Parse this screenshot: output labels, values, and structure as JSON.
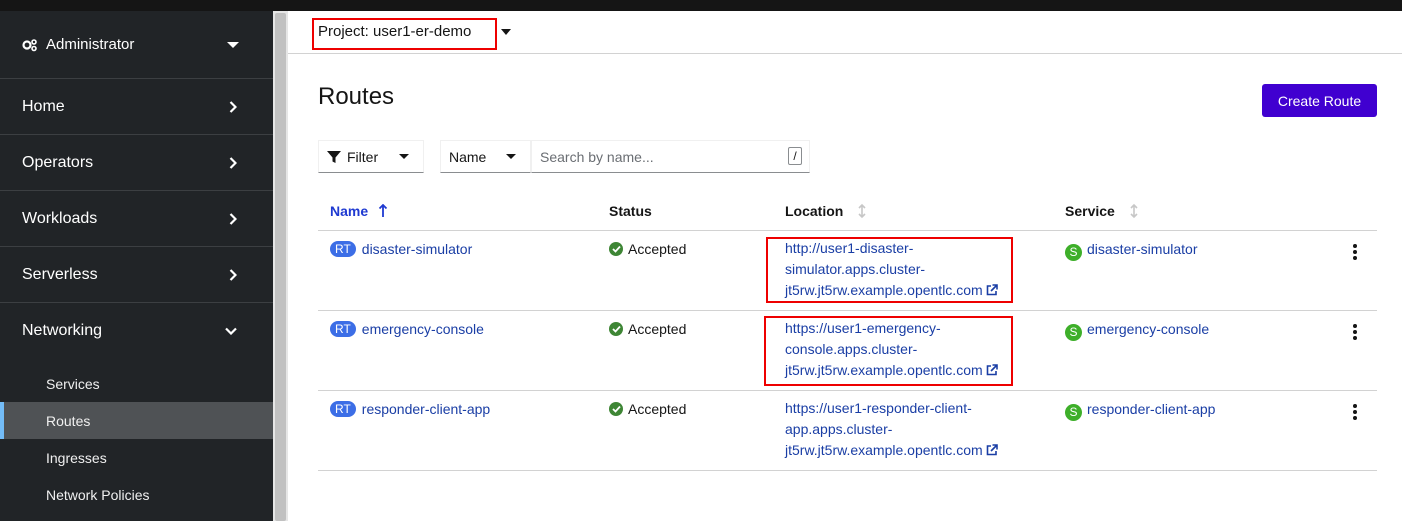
{
  "sidebar": {
    "perspective": "Administrator",
    "sections": [
      "Home",
      "Operators",
      "Workloads",
      "Serverless",
      "Networking"
    ],
    "networking_items": [
      "Services",
      "Routes",
      "Ingresses",
      "Network Policies"
    ],
    "active_item": "Routes"
  },
  "project": {
    "label": "Project: user1-er-demo"
  },
  "page": {
    "title": "Routes",
    "create_label": "Create Route"
  },
  "filter": {
    "label": "Filter",
    "name_label": "Name",
    "search_placeholder": "Search by name...",
    "shortcut": "/"
  },
  "table": {
    "headers": {
      "name": "Name",
      "status": "Status",
      "location": "Location",
      "service": "Service"
    },
    "rows": [
      {
        "badge": "RT",
        "name": "disaster-simulator",
        "status": "Accepted",
        "location_lines": [
          "http://user1-disaster-",
          "simulator.apps.cluster-",
          "jt5rw.jt5rw.example.opentlc.com"
        ],
        "service_badge": "S",
        "service": "disaster-simulator"
      },
      {
        "badge": "RT",
        "name": "emergency-console",
        "status": "Accepted",
        "location_lines": [
          "https://user1-emergency-",
          "console.apps.cluster-",
          "jt5rw.jt5rw.example.opentlc.com"
        ],
        "service_badge": "S",
        "service": "emergency-console"
      },
      {
        "badge": "RT",
        "name": "responder-client-app",
        "status": "Accepted",
        "location_lines": [
          "https://user1-responder-client-",
          "app.apps.cluster-",
          "jt5rw.jt5rw.example.opentlc.com"
        ],
        "service_badge": "S",
        "service": "responder-client-app"
      }
    ]
  },
  "colors": {
    "accent": "#4000d0",
    "link": "#1a3ea5",
    "highlight": "#ee0000",
    "sidebar_bg": "#212427",
    "success": "#3e8635"
  }
}
